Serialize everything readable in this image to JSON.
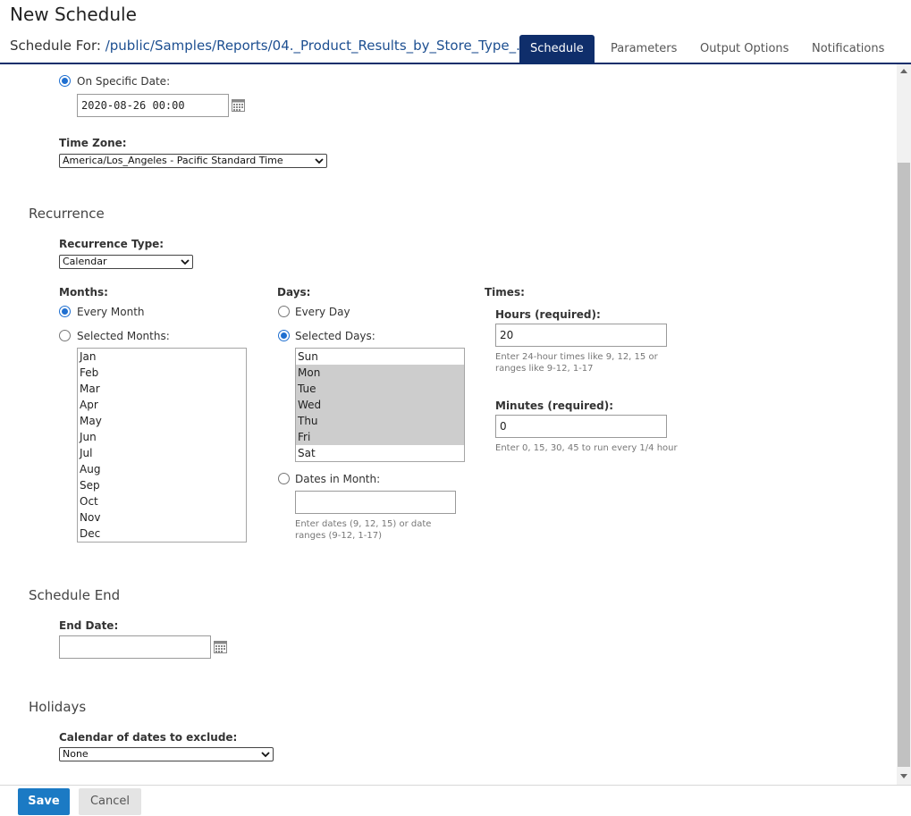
{
  "header": {
    "title": "New Schedule",
    "schedule_for_label": "Schedule For:",
    "schedule_for_path": "/public/Samples/Reports/04._Product_Results_by_Store_Type_..."
  },
  "tabs": [
    {
      "label": "Schedule",
      "active": true
    },
    {
      "label": "Parameters",
      "active": false
    },
    {
      "label": "Output Options",
      "active": false
    },
    {
      "label": "Notifications",
      "active": false
    }
  ],
  "start": {
    "on_specific_date_label": "On Specific Date:",
    "date_value": "2020-08-26 00:00",
    "time_zone_label": "Time Zone:",
    "time_zone_value": "America/Los_Angeles - Pacific Standard Time"
  },
  "recurrence": {
    "section_title": "Recurrence",
    "type_label": "Recurrence Type:",
    "type_value": "Calendar",
    "months": {
      "label": "Months:",
      "every_month_label": "Every Month",
      "selected_months_label": "Selected Months:",
      "options": [
        "Jan",
        "Feb",
        "Mar",
        "Apr",
        "May",
        "Jun",
        "Jul",
        "Aug",
        "Sep",
        "Oct",
        "Nov",
        "Dec"
      ]
    },
    "days": {
      "label": "Days:",
      "every_day_label": "Every Day",
      "selected_days_label": "Selected Days:",
      "options": [
        "Sun",
        "Mon",
        "Tue",
        "Wed",
        "Thu",
        "Fri",
        "Sat"
      ],
      "selected": [
        "Mon",
        "Tue",
        "Wed",
        "Thu",
        "Fri"
      ],
      "dates_in_month_label": "Dates in Month:",
      "dates_in_month_value": "",
      "dates_hint": "Enter dates (9, 12, 15) or date ranges (9-12, 1-17)"
    },
    "times": {
      "label": "Times:",
      "hours_label": "Hours (required):",
      "hours_value": "20",
      "hours_hint": "Enter 24-hour times like 9, 12, 15 or ranges like 9-12, 1-17",
      "minutes_label": "Minutes (required):",
      "minutes_value": "0",
      "minutes_hint": "Enter 0, 15, 30, 45 to run every 1/4 hour"
    }
  },
  "schedule_end": {
    "section_title": "Schedule End",
    "end_date_label": "End Date:",
    "end_date_value": ""
  },
  "holidays": {
    "section_title": "Holidays",
    "calendar_label": "Calendar of dates to exclude:",
    "calendar_value": "None"
  },
  "footer": {
    "save_label": "Save",
    "cancel_label": "Cancel"
  },
  "colors": {
    "tab_active": "#0f2e6b",
    "primary_button": "#1b7ac4",
    "radio_selected": "#1f6fd0",
    "path_link": "#1d4f91"
  }
}
